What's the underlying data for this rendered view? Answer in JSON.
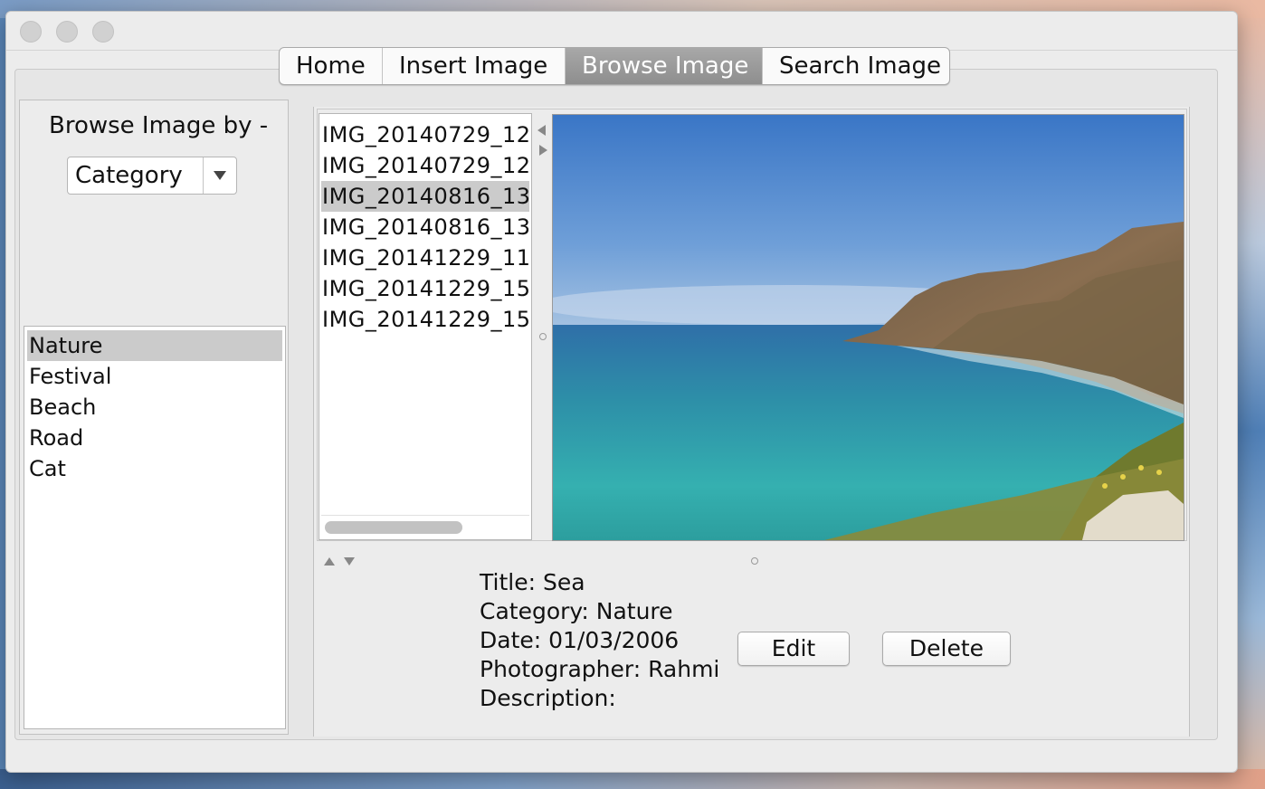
{
  "window": {
    "traffic_lights": [
      "close",
      "minimize",
      "zoom"
    ]
  },
  "tabs": [
    {
      "label": "Home",
      "active": false
    },
    {
      "label": "Insert Image",
      "active": false
    },
    {
      "label": "Browse Image",
      "active": true
    },
    {
      "label": "Search Image",
      "active": false
    }
  ],
  "sidebar": {
    "browse_label": "Browse Image by -",
    "browse_by_selected": "Category",
    "categories": [
      {
        "label": "Nature",
        "selected": true
      },
      {
        "label": "Festival",
        "selected": false
      },
      {
        "label": "Beach",
        "selected": false
      },
      {
        "label": "Road",
        "selected": false
      },
      {
        "label": "Cat",
        "selected": false
      }
    ]
  },
  "files": [
    {
      "label": "IMG_20140729_12",
      "selected": false
    },
    {
      "label": "IMG_20140729_12",
      "selected": false
    },
    {
      "label": "IMG_20140816_13",
      "selected": true
    },
    {
      "label": "IMG_20140816_13",
      "selected": false
    },
    {
      "label": "IMG_20141229_11",
      "selected": false
    },
    {
      "label": "IMG_20141229_15",
      "selected": false
    },
    {
      "label": "IMG_20141229_15",
      "selected": false
    }
  ],
  "details": {
    "title": "Title: Sea",
    "category": "Category: Nature",
    "date": "Date: 01/03/2006",
    "photographer": "Photographer: Rahmi",
    "description": "Description:"
  },
  "actions": {
    "edit_label": "Edit",
    "delete_label": "Delete"
  },
  "colors": {
    "active_tab": "#999999",
    "selection": "#cbcbcb",
    "window_bg": "#ececec"
  }
}
